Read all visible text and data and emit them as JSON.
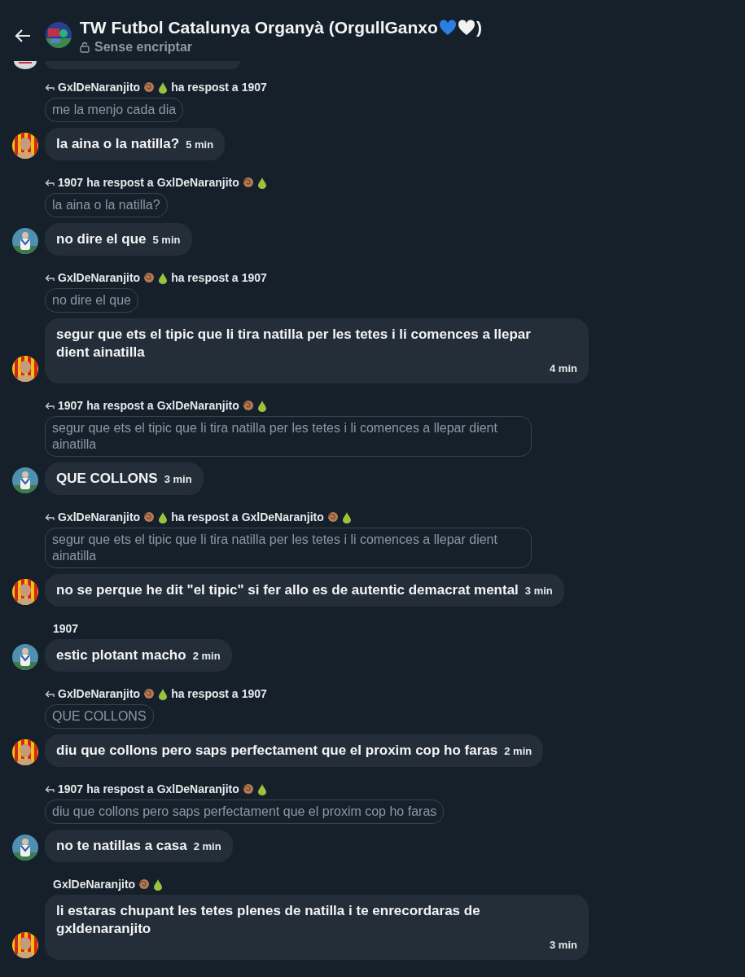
{
  "header": {
    "title": "TW Futbol Catalunya Organyà (OrgullGanxo",
    "title_hearts": true,
    "title_end": ")",
    "subtitle": "Sense encriptar"
  },
  "cut_message": {
    "avatar": {
      "kind": "crest"
    }
  },
  "messages": [
    {
      "avatar": {
        "kind": "catalan"
      },
      "reply": {
        "from": {
          "name": "GxlDeNaranjito",
          "badges": true
        },
        "verb": "ha respost a",
        "to": {
          "name": "1907",
          "badges": false
        },
        "quote": "me la menjo cada dia"
      },
      "text": "la aina o la natilla?",
      "time": "5 min"
    },
    {
      "avatar": {
        "kind": "kit"
      },
      "reply": {
        "from": {
          "name": "1907",
          "badges": false
        },
        "verb": "ha respost a",
        "to": {
          "name": "GxlDeNaranjito",
          "badges": true
        },
        "quote": "la aina o la natilla?"
      },
      "text": "no dire el que",
      "time": "5 min"
    },
    {
      "avatar": {
        "kind": "catalan"
      },
      "reply": {
        "from": {
          "name": "GxlDeNaranjito",
          "badges": true
        },
        "verb": "ha respost a",
        "to": {
          "name": "1907",
          "badges": false
        },
        "quote": "no dire el que"
      },
      "text": "segur que ets el tipic que li tira natilla per les tetes i li comences a llepar dient ainatilla",
      "time": "4 min"
    },
    {
      "avatar": {
        "kind": "kit"
      },
      "reply": {
        "from": {
          "name": "1907",
          "badges": false
        },
        "verb": "ha respost a",
        "to": {
          "name": "GxlDeNaranjito",
          "badges": true
        },
        "quote": "segur que ets el tipic que li tira natilla per les tetes i li comences a llepar dient ainatilla"
      },
      "text": "QUE COLLONS",
      "time": "3 min"
    },
    {
      "avatar": {
        "kind": "catalan"
      },
      "reply": {
        "from": {
          "name": "GxlDeNaranjito",
          "badges": true
        },
        "verb": "ha respost a",
        "to": {
          "name": "GxlDeNaranjito",
          "badges": true
        },
        "quote": "segur que ets el tipic que li tira natilla per les tetes i li comences a llepar dient ainatilla"
      },
      "text": "no se perque he dit \"el tipic\" si fer allo es de autentic demacrat mental",
      "time": "3 min"
    },
    {
      "avatar": {
        "kind": "kit"
      },
      "sender": {
        "name": "1907",
        "badges": false
      },
      "text": "estic plotant macho",
      "time": "2 min"
    },
    {
      "avatar": {
        "kind": "catalan"
      },
      "reply": {
        "from": {
          "name": "GxlDeNaranjito",
          "badges": true
        },
        "verb": "ha respost a",
        "to": {
          "name": "1907",
          "badges": false
        },
        "quote": "QUE COLLONS"
      },
      "text": "diu que collons pero saps perfectament que el proxim cop ho faras",
      "time": "2 min"
    },
    {
      "avatar": {
        "kind": "kit"
      },
      "reply": {
        "from": {
          "name": "1907",
          "badges": false
        },
        "verb": "ha respost a",
        "to": {
          "name": "GxlDeNaranjito",
          "badges": true
        },
        "quote": "diu que collons pero saps perfectament que el proxim cop ho faras"
      },
      "text": "no te natillas a casa",
      "time": "2 min"
    },
    {
      "avatar": {
        "kind": "catalan"
      },
      "sender": {
        "name": "GxlDeNaranjito",
        "badges": true
      },
      "text": "li estaras chupant les tetes plenes de natilla i te enrecordaras de gxldenaranjito",
      "time": "3 min"
    }
  ]
}
